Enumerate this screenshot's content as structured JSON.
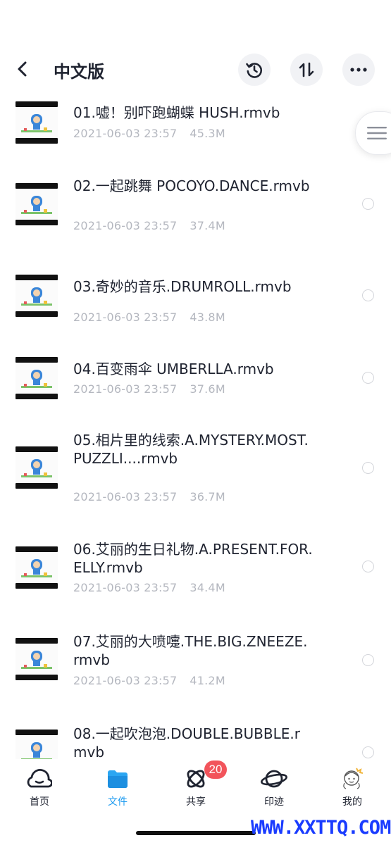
{
  "header": {
    "title": "中文版",
    "back_icon": "chevron-left-icon",
    "history_icon": "history-icon",
    "sort_icon": "sort-icon",
    "more_icon": "more-icon"
  },
  "files": [
    {
      "name": "01.嘘！别吓跑蝴蝶 HUSH.rmvb",
      "date": "2021-06-03 23:57",
      "size": "45.3M"
    },
    {
      "name": "02.一起跳舞 POCOYO.DANCE.rmvb",
      "date": "2021-06-03 23:57",
      "size": "37.4M"
    },
    {
      "name": "03.奇妙的音乐.DRUMROLL.rmvb",
      "date": "2021-06-03 23:57",
      "size": "43.8M"
    },
    {
      "name": "04.百变雨伞 UMBERLLA.rmvb",
      "date": "2021-06-03 23:57",
      "size": "37.6M"
    },
    {
      "name": "05.相片里的线索.A.MYSTERY.MOST.PUZZLI....rmvb",
      "date": "2021-06-03 23:57",
      "size": "36.7M"
    },
    {
      "name": "06.艾丽的生日礼物.A.PRESENT.FOR.ELLY.rmvb",
      "date": "2021-06-03 23:57",
      "size": "34.4M"
    },
    {
      "name": "07.艾丽的大喷嚏.THE.BIG.ZNEEZE.rmvb",
      "date": "2021-06-03 23:57",
      "size": "41.2M"
    },
    {
      "name": "08.一起吹泡泡.DOUBLE.BUBBLE.rmvb",
      "date": "",
      "size": ""
    }
  ],
  "tabbar": {
    "items": [
      {
        "label": "首页",
        "icon": "home-cloud-icon"
      },
      {
        "label": "文件",
        "icon": "folder-icon"
      },
      {
        "label": "共享",
        "icon": "share-orbit-icon"
      },
      {
        "label": "印迹",
        "icon": "planet-icon"
      },
      {
        "label": "我的",
        "icon": "avatar-icon"
      }
    ],
    "active_index": 1,
    "share_badge": "20"
  },
  "watermark": "WWW.XXTTQ.COM",
  "colors": {
    "accent": "#1d9bf0",
    "badge": "#f2545b",
    "text": "#1f2330",
    "meta": "#b4b7bf",
    "watermark": "#1a3cff"
  }
}
